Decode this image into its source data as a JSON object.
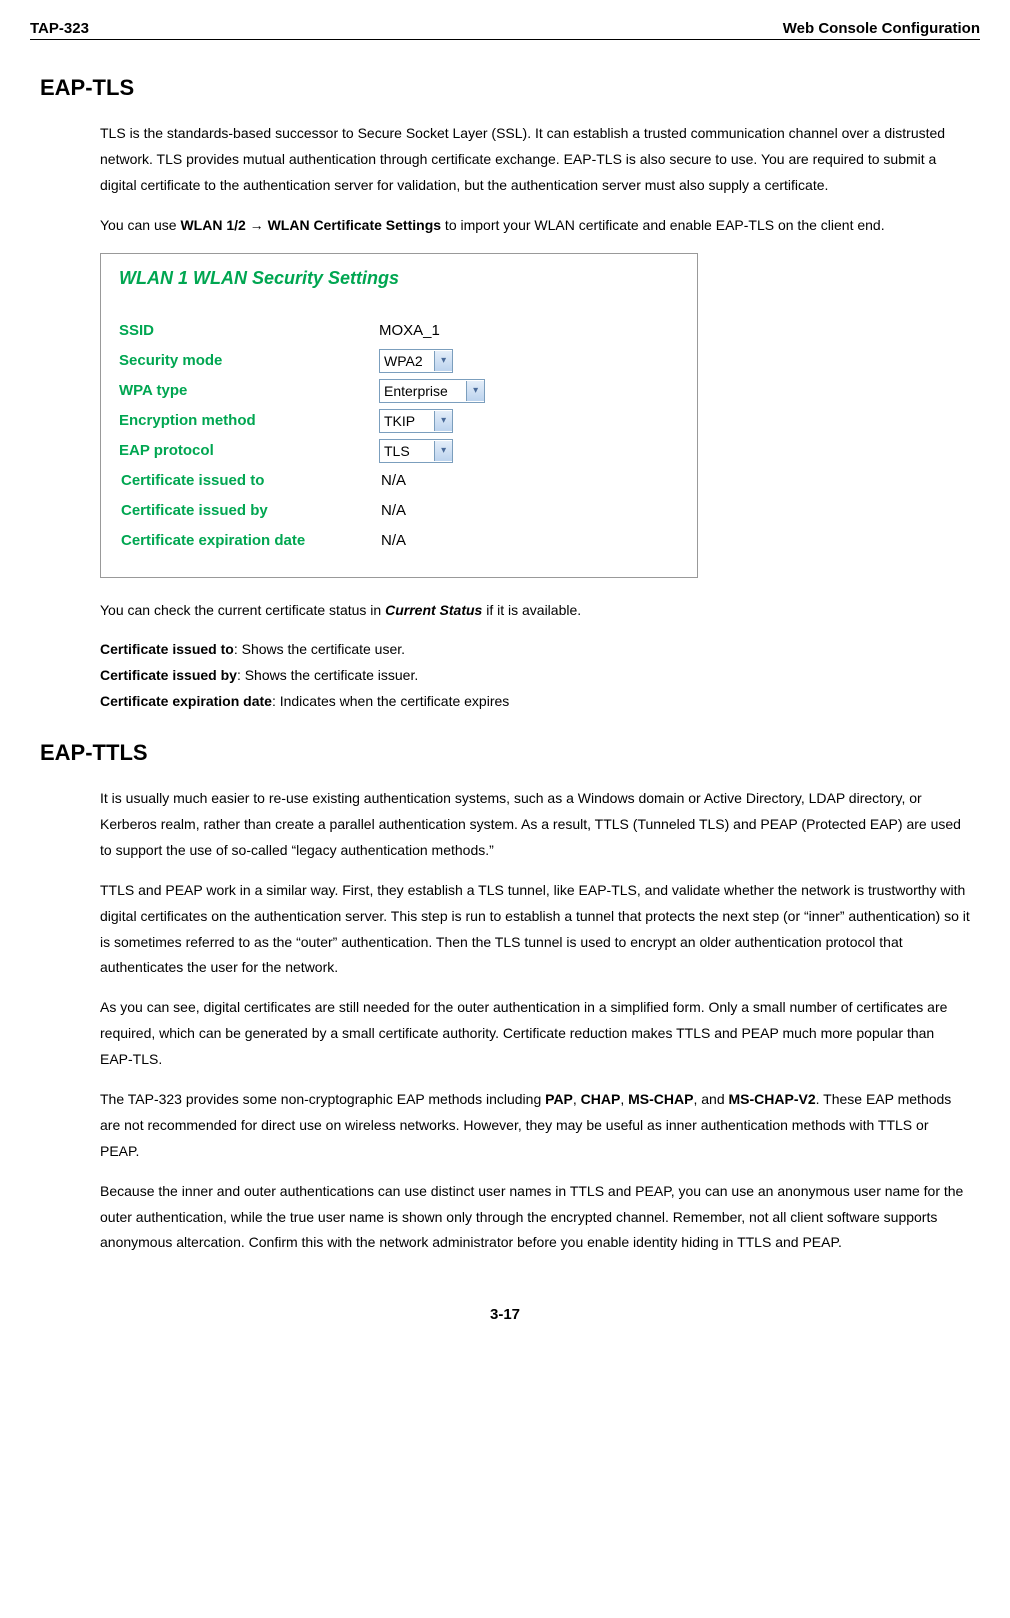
{
  "header": {
    "left": "TAP-323",
    "right": "Web Console Configuration"
  },
  "sec1": {
    "title": "EAP-TLS",
    "p1": "TLS is the standards-based successor to Secure Socket Layer (SSL). It can establish a trusted communication channel over a distrusted network. TLS provides mutual authentication through certificate exchange. EAP-TLS is also secure to use. You are required to submit a digital certificate to the authentication server for validation, but the authentication server must also supply a certificate.",
    "p2a": "You can use ",
    "p2b": "WLAN 1/2 → WLAN Certificate Settings",
    "p2c": " to import your WLAN certificate and enable EAP-TLS on the client end.",
    "p3a": "You can check the current certificate status in ",
    "p3b": "Current Status",
    "p3c": " if it is available.",
    "li1a": "Certificate issued to",
    "li1b": ": Shows the certificate user.",
    "li2a": "Certificate issued by",
    "li2b": ": Shows the certificate issuer.",
    "li3a": "Certificate expiration date",
    "li3b": ": Indicates when the certificate expires"
  },
  "panel": {
    "title": "WLAN 1  WLAN Security Settings",
    "rows": {
      "ssid_l": "SSID",
      "ssid_v": "MOXA_1",
      "sec_l": "Security mode",
      "sec_v": "WPA2",
      "wpa_l": "WPA type",
      "wpa_v": "Enterprise",
      "enc_l": "Encryption method",
      "enc_v": "TKIP",
      "eap_l": "EAP protocol",
      "eap_v": "TLS",
      "cto_l": "Certificate issued to",
      "cto_v": "N/A",
      "cby_l": "Certificate issued by",
      "cby_v": "N/A",
      "cex_l": "Certificate expiration date",
      "cex_v": "N/A"
    }
  },
  "sec2": {
    "title": "EAP-TTLS",
    "p1": "It is usually much easier to re-use existing authentication systems, such as a Windows domain or Active Directory, LDAP directory, or Kerberos realm, rather than create a parallel authentication system. As a result, TTLS (Tunneled TLS) and PEAP (Protected EAP) are used to support the use of so-called “legacy authentication methods.”",
    "p2": "TTLS and PEAP work in a similar way. First, they establish a TLS tunnel, like EAP-TLS, and validate whether the network is trustworthy with digital certificates on the authentication server. This step is run to establish a tunnel that protects the next step (or “inner” authentication) so it is sometimes referred to as the “outer” authentication. Then the TLS tunnel is used to encrypt an older authentication protocol that authenticates the user for the network.",
    "p3": "As you can see, digital certificates are still needed for the outer authentication in a simplified form. Only a small number of certificates are required, which can be generated by a small certificate authority. Certificate reduction makes TTLS and PEAP much more popular than EAP-TLS.",
    "p4a": "The TAP-323 provides some non-cryptographic EAP methods including ",
    "p4b": "PAP",
    "p4c": ", ",
    "p4d": "CHAP",
    "p4e": ", ",
    "p4f": "MS-CHAP",
    "p4g": ", and ",
    "p4h": "MS-CHAP-V2",
    "p4i": ". These EAP methods are not recommended for direct use on wireless networks. However, they may be useful as inner authentication methods with TTLS or PEAP.",
    "p5": "Because the inner and outer authentications can use distinct user names in TTLS and PEAP, you can use an anonymous user name for the outer authentication, while the true user name is shown only through the encrypted channel. Remember, not all client software supports anonymous altercation. Confirm this with the network administrator before you enable identity hiding in TTLS and PEAP."
  },
  "pagenum": "3-17"
}
